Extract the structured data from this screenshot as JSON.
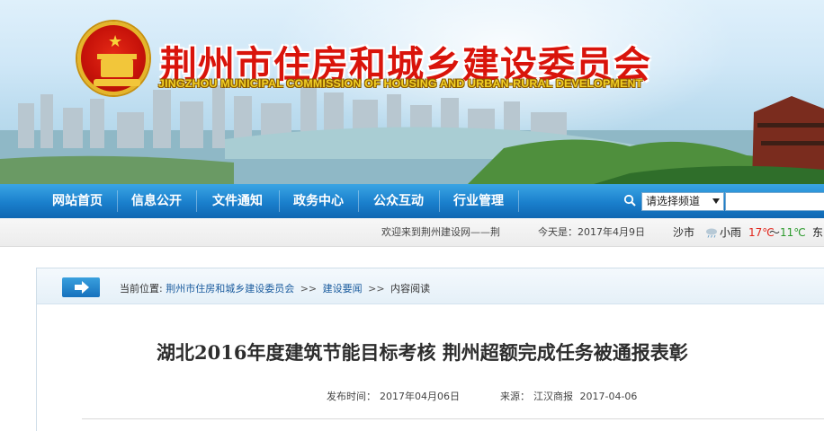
{
  "header": {
    "title": "荆州市住房和城乡建设委员会",
    "subtitle": "JINGZHOU MUNICIPAL COMMISSION OF HOUSING AND URBAN-RURAL DEVELOPMENT"
  },
  "nav": {
    "items": [
      "网站首页",
      "信息公开",
      "文件通知",
      "政务中心",
      "公众互动",
      "行业管理"
    ],
    "channel_select": "请选择频道"
  },
  "infobar": {
    "welcome": "欢迎来到荆州建设网——荆",
    "today": "今天是：2017年4月9日",
    "city": "沙市",
    "weather": "小雨",
    "temp_high": "17℃",
    "temp_sep": "～",
    "temp_low": "11℃",
    "wind": "东"
  },
  "breadcrumb": {
    "prefix": "当前位置:",
    "items": [
      "荆州市住房和城乡建设委员会",
      "建设要闻",
      "内容阅读"
    ],
    "separator": ">>"
  },
  "article": {
    "title": "湖北2016年度建筑节能目标考核  荆州超额完成任务被通报表彰",
    "publish_label": "发布时间：",
    "publish_date": "2017年04月06日",
    "source_label": "来源：",
    "source": "江汉商报",
    "source_date": "2017-04-06"
  },
  "colors": {
    "nav_blue": "#1a7fcc",
    "title_red": "#d9140b",
    "subtitle_gold": "#f2d024",
    "link_blue": "#1b5c9e",
    "temp_high": "#e1251b",
    "temp_low": "#2c9a2c"
  }
}
